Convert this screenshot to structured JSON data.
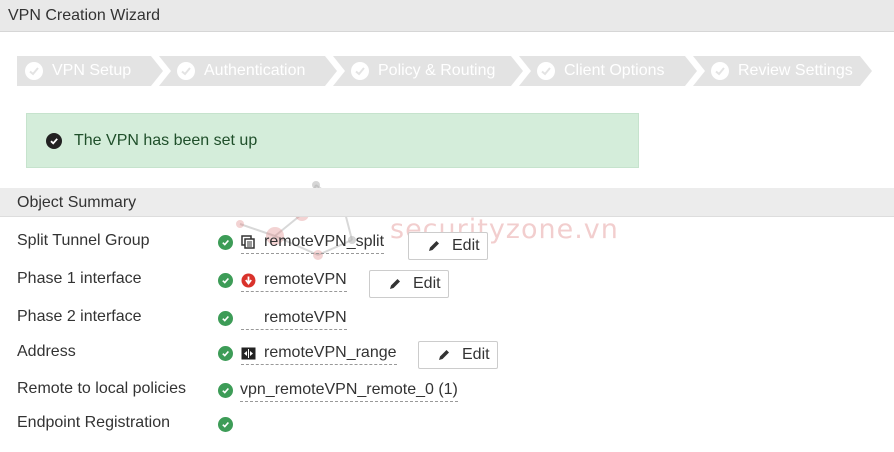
{
  "window": {
    "title": "VPN Creation Wizard"
  },
  "steps": [
    {
      "label": "VPN Setup",
      "done": true
    },
    {
      "label": "Authentication",
      "done": true
    },
    {
      "label": "Policy & Routing",
      "done": true
    },
    {
      "label": "Client Options",
      "done": true
    },
    {
      "label": "Review Settings",
      "done": true
    }
  ],
  "banner": {
    "message": "The VPN has been set up",
    "icon": "check-circle-icon"
  },
  "summary": {
    "header": "Object Summary",
    "rows": [
      {
        "label": "Split Tunnel Group",
        "value": "remoteVPN_split",
        "value_icon": "address-group-icon",
        "edit_label": "Edit"
      },
      {
        "label": "Phase 1 interface",
        "value": "remoteVPN",
        "value_icon": "tunnel-down-icon",
        "edit_label": "Edit"
      },
      {
        "label": "Phase 2 interface",
        "value": "remoteVPN",
        "value_icon": ""
      },
      {
        "label": "Address",
        "value": "remoteVPN_range",
        "value_icon": "ip-range-icon",
        "edit_label": "Edit"
      },
      {
        "label": "Remote to local policies",
        "value": "vpn_remoteVPN_remote_0 (1)"
      },
      {
        "label": "Endpoint Registration",
        "value": ""
      }
    ]
  },
  "watermark": {
    "text": "securityzone.vn"
  },
  "colors": {
    "status_ok": "#3d9c57",
    "status_down": "#d9322b",
    "banner_bg": "#d4edda",
    "step_bg": "#e3e3e3"
  }
}
